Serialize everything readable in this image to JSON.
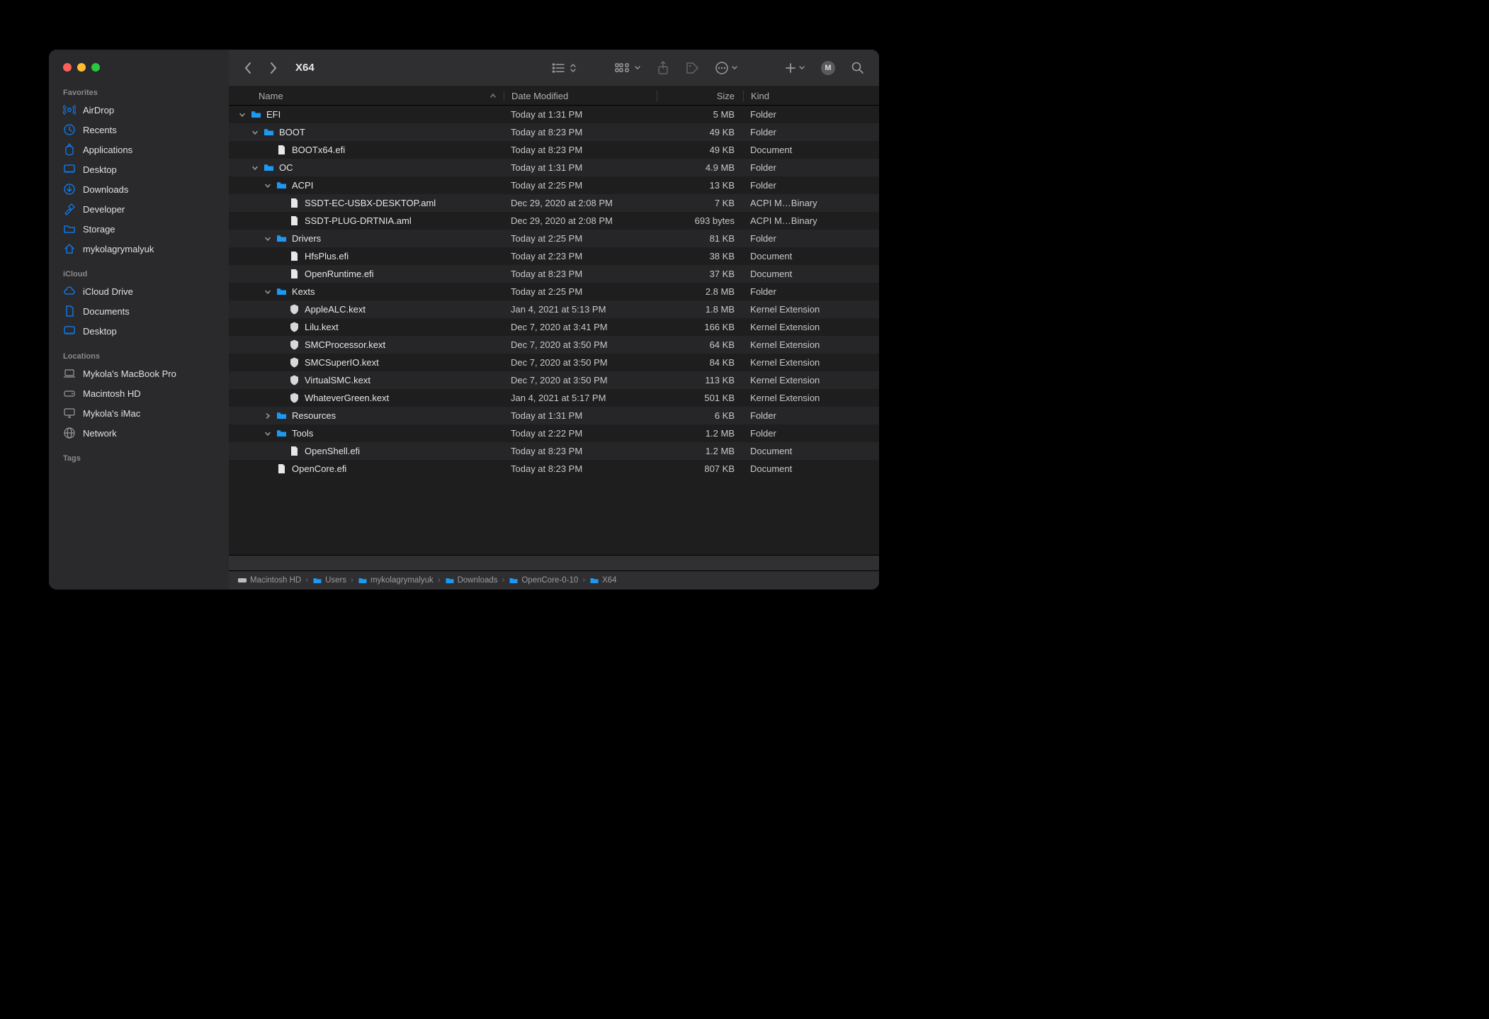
{
  "window": {
    "title": "X64"
  },
  "sidebar": {
    "sections": [
      {
        "title": "Favorites",
        "items": [
          {
            "icon": "airdrop",
            "label": "AirDrop"
          },
          {
            "icon": "clock",
            "label": "Recents"
          },
          {
            "icon": "apps",
            "label": "Applications"
          },
          {
            "icon": "desktop",
            "label": "Desktop"
          },
          {
            "icon": "download",
            "label": "Downloads"
          },
          {
            "icon": "hammer",
            "label": "Developer"
          },
          {
            "icon": "folder",
            "label": "Storage"
          },
          {
            "icon": "home",
            "label": "mykolagrymalyuk"
          }
        ]
      },
      {
        "title": "iCloud",
        "items": [
          {
            "icon": "cloud",
            "label": "iCloud Drive"
          },
          {
            "icon": "doc",
            "label": "Documents"
          },
          {
            "icon": "desktop",
            "label": "Desktop"
          }
        ]
      },
      {
        "title": "Locations",
        "items": [
          {
            "icon": "laptop",
            "label": "Mykola's MacBook Pro",
            "grey": true
          },
          {
            "icon": "disk",
            "label": "Macintosh HD",
            "grey": true
          },
          {
            "icon": "imac",
            "label": "Mykola's iMac",
            "grey": true
          },
          {
            "icon": "globe",
            "label": "Network",
            "grey": true
          }
        ]
      },
      {
        "title": "Tags",
        "items": []
      }
    ]
  },
  "columns": {
    "name": "Name",
    "date": "Date Modified",
    "size": "Size",
    "kind": "Kind"
  },
  "rows": [
    {
      "depth": 0,
      "expand": "open",
      "icon": "folder",
      "name": "EFI",
      "date": "Today at 1:31 PM",
      "size": "5 MB",
      "kind": "Folder"
    },
    {
      "depth": 1,
      "expand": "open",
      "icon": "folder",
      "name": "BOOT",
      "date": "Today at 8:23 PM",
      "size": "49 KB",
      "kind": "Folder"
    },
    {
      "depth": 2,
      "expand": "none",
      "icon": "doc",
      "name": "BOOTx64.efi",
      "date": "Today at 8:23 PM",
      "size": "49 KB",
      "kind": "Document"
    },
    {
      "depth": 1,
      "expand": "open",
      "icon": "folder",
      "name": "OC",
      "date": "Today at 1:31 PM",
      "size": "4.9 MB",
      "kind": "Folder"
    },
    {
      "depth": 2,
      "expand": "open",
      "icon": "folder",
      "name": "ACPI",
      "date": "Today at 2:25 PM",
      "size": "13 KB",
      "kind": "Folder"
    },
    {
      "depth": 3,
      "expand": "none",
      "icon": "doc",
      "name": "SSDT-EC-USBX-DESKTOP.aml",
      "date": "Dec 29, 2020 at 2:08 PM",
      "size": "7 KB",
      "kind": "ACPI M…Binary"
    },
    {
      "depth": 3,
      "expand": "none",
      "icon": "doc",
      "name": "SSDT-PLUG-DRTNIA.aml",
      "date": "Dec 29, 2020 at 2:08 PM",
      "size": "693 bytes",
      "kind": "ACPI M…Binary"
    },
    {
      "depth": 2,
      "expand": "open",
      "icon": "folder",
      "name": "Drivers",
      "date": "Today at 2:25 PM",
      "size": "81 KB",
      "kind": "Folder"
    },
    {
      "depth": 3,
      "expand": "none",
      "icon": "doc",
      "name": "HfsPlus.efi",
      "date": "Today at 2:23 PM",
      "size": "38 KB",
      "kind": "Document"
    },
    {
      "depth": 3,
      "expand": "none",
      "icon": "doc",
      "name": "OpenRuntime.efi",
      "date": "Today at 8:23 PM",
      "size": "37 KB",
      "kind": "Document"
    },
    {
      "depth": 2,
      "expand": "open",
      "icon": "folder",
      "name": "Kexts",
      "date": "Today at 2:25 PM",
      "size": "2.8 MB",
      "kind": "Folder"
    },
    {
      "depth": 3,
      "expand": "none",
      "icon": "kext",
      "name": "AppleALC.kext",
      "date": "Jan 4, 2021 at 5:13 PM",
      "size": "1.8 MB",
      "kind": "Kernel Extension"
    },
    {
      "depth": 3,
      "expand": "none",
      "icon": "kext",
      "name": "Lilu.kext",
      "date": "Dec 7, 2020 at 3:41 PM",
      "size": "166 KB",
      "kind": "Kernel Extension"
    },
    {
      "depth": 3,
      "expand": "none",
      "icon": "kext",
      "name": "SMCProcessor.kext",
      "date": "Dec 7, 2020 at 3:50 PM",
      "size": "64 KB",
      "kind": "Kernel Extension"
    },
    {
      "depth": 3,
      "expand": "none",
      "icon": "kext",
      "name": "SMCSuperIO.kext",
      "date": "Dec 7, 2020 at 3:50 PM",
      "size": "84 KB",
      "kind": "Kernel Extension"
    },
    {
      "depth": 3,
      "expand": "none",
      "icon": "kext",
      "name": "VirtualSMC.kext",
      "date": "Dec 7, 2020 at 3:50 PM",
      "size": "113 KB",
      "kind": "Kernel Extension"
    },
    {
      "depth": 3,
      "expand": "none",
      "icon": "kext",
      "name": "WhateverGreen.kext",
      "date": "Jan 4, 2021 at 5:17 PM",
      "size": "501 KB",
      "kind": "Kernel Extension"
    },
    {
      "depth": 2,
      "expand": "closed",
      "icon": "folder",
      "name": "Resources",
      "date": "Today at 1:31 PM",
      "size": "6 KB",
      "kind": "Folder"
    },
    {
      "depth": 2,
      "expand": "open",
      "icon": "folder",
      "name": "Tools",
      "date": "Today at 2:22 PM",
      "size": "1.2 MB",
      "kind": "Folder"
    },
    {
      "depth": 3,
      "expand": "none",
      "icon": "doc",
      "name": "OpenShell.efi",
      "date": "Today at 8:23 PM",
      "size": "1.2 MB",
      "kind": "Document"
    },
    {
      "depth": 2,
      "expand": "none",
      "icon": "doc",
      "name": "OpenCore.efi",
      "date": "Today at 8:23 PM",
      "size": "807 KB",
      "kind": "Document"
    }
  ],
  "pathbar": [
    {
      "icon": "disk",
      "label": "Macintosh HD"
    },
    {
      "icon": "folder",
      "label": "Users"
    },
    {
      "icon": "folder",
      "label": "mykolagrymalyuk"
    },
    {
      "icon": "folder",
      "label": "Downloads"
    },
    {
      "icon": "folder",
      "label": "OpenCore-0-10"
    },
    {
      "icon": "folder",
      "label": "X64"
    }
  ],
  "toolbar_badge": "M"
}
